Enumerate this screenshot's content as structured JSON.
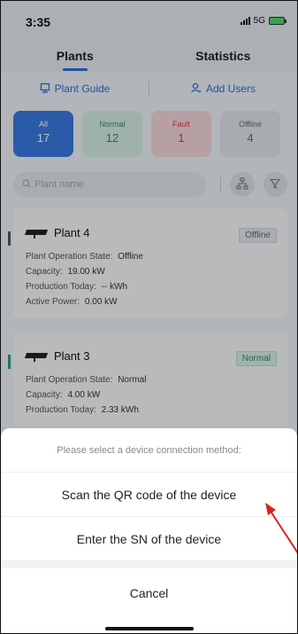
{
  "status": {
    "time": "3:35",
    "network": "5G"
  },
  "tabs": [
    {
      "label": "Plants",
      "active": true
    },
    {
      "label": "Statistics",
      "active": false
    }
  ],
  "actions": {
    "plant_guide": "Plant Guide",
    "add_users": "Add Users"
  },
  "filters": [
    {
      "label": "All",
      "count": "17"
    },
    {
      "label": "Normal",
      "count": "12"
    },
    {
      "label": "Fault",
      "count": "1"
    },
    {
      "label": "Offline",
      "count": "4"
    }
  ],
  "search": {
    "placeholder": "Plant name"
  },
  "plants": [
    {
      "name": "Plant 4",
      "badge": "Offline",
      "state_label": "Plant Operation State:",
      "state_value": "Offline",
      "capacity_label": "Capacity:",
      "capacity_value": "19.00 kW",
      "production_label": "Production Today:",
      "production_value": "-- kWh",
      "power_label": "Active Power:",
      "power_value": "0.00 kW"
    },
    {
      "name": "Plant 3",
      "badge": "Normal",
      "state_label": "Plant Operation State:",
      "state_value": "Normal",
      "capacity_label": "Capacity:",
      "capacity_value": "4.00 kW",
      "production_label": "Production Today:",
      "production_value": "2.33 kWh"
    }
  ],
  "sheet": {
    "prompt": "Please select a device connection method:",
    "scan_option": "Scan the QR code of the device",
    "sn_option": "Enter the SN of the device",
    "cancel": "Cancel"
  },
  "colors": {
    "accent": "#2f6bd8",
    "annotation_arrow": "#e02020"
  }
}
